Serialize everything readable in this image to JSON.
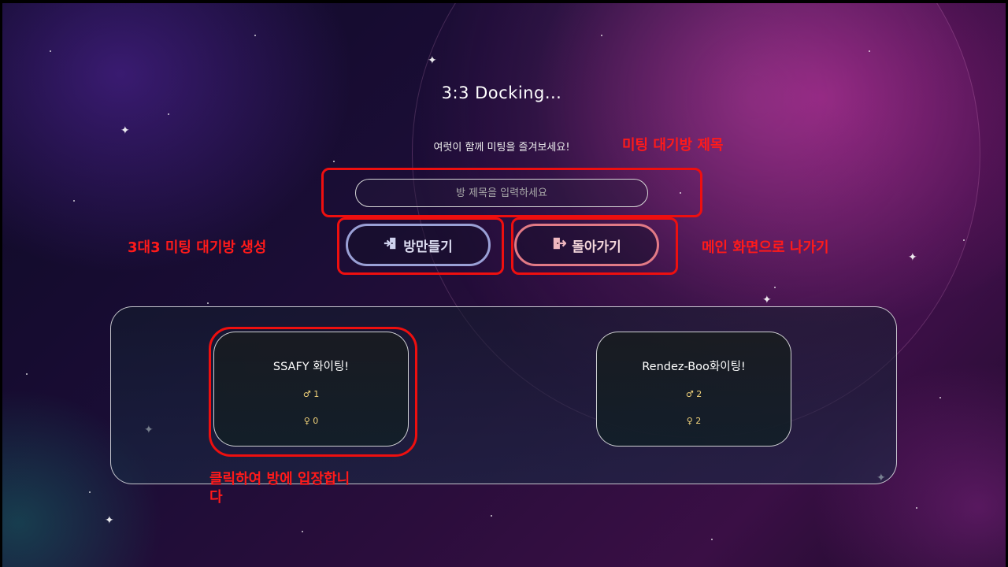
{
  "header": {
    "title": "3:3 Docking...",
    "subtitle": "여럿이 함께 미팅을 즐겨보세요!"
  },
  "room_form": {
    "title_placeholder": "방 제목을 입력하세요",
    "create_button_label": "방만들기",
    "back_button_label": "돌아가기"
  },
  "rooms": [
    {
      "name": "SSAFY 화이팅!",
      "male_symbol": "♂",
      "male_count": "1",
      "female_symbol": "♀",
      "female_count": "0"
    },
    {
      "name": "Rendez-Boo화이팅!",
      "male_symbol": "♂",
      "male_count": "2",
      "female_symbol": "♀",
      "female_count": "2"
    }
  ],
  "annotations": {
    "room_title": "미팅 대기방 제목",
    "create_room": "3대3 미팅 대기방 생성",
    "go_main": "메인 화면으로 나가기",
    "enter_room_line1": "클릭하여 방에 입장합니",
    "enter_room_line2": "다"
  },
  "colors": {
    "annotation": "#ee0f0f",
    "create_button_border": "#9aa0d6",
    "back_button_border": "#e27a86",
    "gender_count": "#f1d27a"
  },
  "icons": {
    "create_button": "door-enter-icon",
    "back_button": "door-exit-icon"
  }
}
